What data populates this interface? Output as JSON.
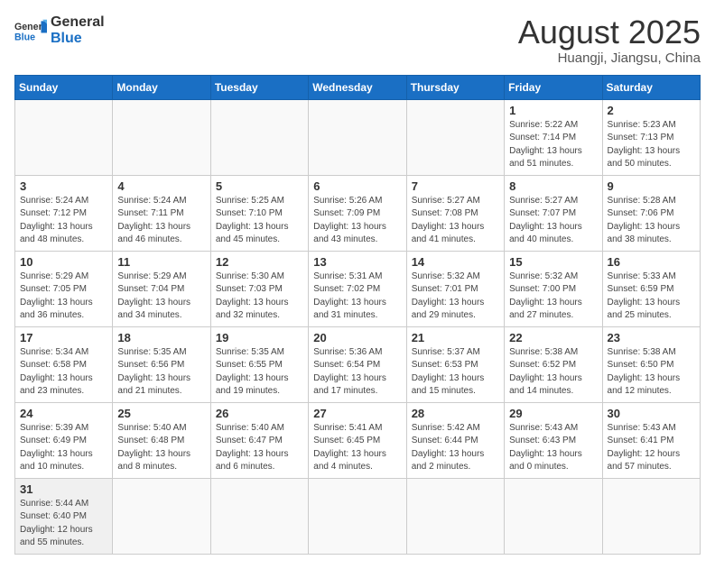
{
  "header": {
    "logo_general": "General",
    "logo_blue": "Blue",
    "month_year": "August 2025",
    "location": "Huangji, Jiangsu, China"
  },
  "weekdays": [
    "Sunday",
    "Monday",
    "Tuesday",
    "Wednesday",
    "Thursday",
    "Friday",
    "Saturday"
  ],
  "weeks": [
    [
      {
        "day": "",
        "info": ""
      },
      {
        "day": "",
        "info": ""
      },
      {
        "day": "",
        "info": ""
      },
      {
        "day": "",
        "info": ""
      },
      {
        "day": "",
        "info": ""
      },
      {
        "day": "1",
        "info": "Sunrise: 5:22 AM\nSunset: 7:14 PM\nDaylight: 13 hours and 51 minutes."
      },
      {
        "day": "2",
        "info": "Sunrise: 5:23 AM\nSunset: 7:13 PM\nDaylight: 13 hours and 50 minutes."
      }
    ],
    [
      {
        "day": "3",
        "info": "Sunrise: 5:24 AM\nSunset: 7:12 PM\nDaylight: 13 hours and 48 minutes."
      },
      {
        "day": "4",
        "info": "Sunrise: 5:24 AM\nSunset: 7:11 PM\nDaylight: 13 hours and 46 minutes."
      },
      {
        "day": "5",
        "info": "Sunrise: 5:25 AM\nSunset: 7:10 PM\nDaylight: 13 hours and 45 minutes."
      },
      {
        "day": "6",
        "info": "Sunrise: 5:26 AM\nSunset: 7:09 PM\nDaylight: 13 hours and 43 minutes."
      },
      {
        "day": "7",
        "info": "Sunrise: 5:27 AM\nSunset: 7:08 PM\nDaylight: 13 hours and 41 minutes."
      },
      {
        "day": "8",
        "info": "Sunrise: 5:27 AM\nSunset: 7:07 PM\nDaylight: 13 hours and 40 minutes."
      },
      {
        "day": "9",
        "info": "Sunrise: 5:28 AM\nSunset: 7:06 PM\nDaylight: 13 hours and 38 minutes."
      }
    ],
    [
      {
        "day": "10",
        "info": "Sunrise: 5:29 AM\nSunset: 7:05 PM\nDaylight: 13 hours and 36 minutes."
      },
      {
        "day": "11",
        "info": "Sunrise: 5:29 AM\nSunset: 7:04 PM\nDaylight: 13 hours and 34 minutes."
      },
      {
        "day": "12",
        "info": "Sunrise: 5:30 AM\nSunset: 7:03 PM\nDaylight: 13 hours and 32 minutes."
      },
      {
        "day": "13",
        "info": "Sunrise: 5:31 AM\nSunset: 7:02 PM\nDaylight: 13 hours and 31 minutes."
      },
      {
        "day": "14",
        "info": "Sunrise: 5:32 AM\nSunset: 7:01 PM\nDaylight: 13 hours and 29 minutes."
      },
      {
        "day": "15",
        "info": "Sunrise: 5:32 AM\nSunset: 7:00 PM\nDaylight: 13 hours and 27 minutes."
      },
      {
        "day": "16",
        "info": "Sunrise: 5:33 AM\nSunset: 6:59 PM\nDaylight: 13 hours and 25 minutes."
      }
    ],
    [
      {
        "day": "17",
        "info": "Sunrise: 5:34 AM\nSunset: 6:58 PM\nDaylight: 13 hours and 23 minutes."
      },
      {
        "day": "18",
        "info": "Sunrise: 5:35 AM\nSunset: 6:56 PM\nDaylight: 13 hours and 21 minutes."
      },
      {
        "day": "19",
        "info": "Sunrise: 5:35 AM\nSunset: 6:55 PM\nDaylight: 13 hours and 19 minutes."
      },
      {
        "day": "20",
        "info": "Sunrise: 5:36 AM\nSunset: 6:54 PM\nDaylight: 13 hours and 17 minutes."
      },
      {
        "day": "21",
        "info": "Sunrise: 5:37 AM\nSunset: 6:53 PM\nDaylight: 13 hours and 15 minutes."
      },
      {
        "day": "22",
        "info": "Sunrise: 5:38 AM\nSunset: 6:52 PM\nDaylight: 13 hours and 14 minutes."
      },
      {
        "day": "23",
        "info": "Sunrise: 5:38 AM\nSunset: 6:50 PM\nDaylight: 13 hours and 12 minutes."
      }
    ],
    [
      {
        "day": "24",
        "info": "Sunrise: 5:39 AM\nSunset: 6:49 PM\nDaylight: 13 hours and 10 minutes."
      },
      {
        "day": "25",
        "info": "Sunrise: 5:40 AM\nSunset: 6:48 PM\nDaylight: 13 hours and 8 minutes."
      },
      {
        "day": "26",
        "info": "Sunrise: 5:40 AM\nSunset: 6:47 PM\nDaylight: 13 hours and 6 minutes."
      },
      {
        "day": "27",
        "info": "Sunrise: 5:41 AM\nSunset: 6:45 PM\nDaylight: 13 hours and 4 minutes."
      },
      {
        "day": "28",
        "info": "Sunrise: 5:42 AM\nSunset: 6:44 PM\nDaylight: 13 hours and 2 minutes."
      },
      {
        "day": "29",
        "info": "Sunrise: 5:43 AM\nSunset: 6:43 PM\nDaylight: 13 hours and 0 minutes."
      },
      {
        "day": "30",
        "info": "Sunrise: 5:43 AM\nSunset: 6:41 PM\nDaylight: 12 hours and 57 minutes."
      }
    ],
    [
      {
        "day": "31",
        "info": "Sunrise: 5:44 AM\nSunset: 6:40 PM\nDaylight: 12 hours and 55 minutes."
      },
      {
        "day": "",
        "info": ""
      },
      {
        "day": "",
        "info": ""
      },
      {
        "day": "",
        "info": ""
      },
      {
        "day": "",
        "info": ""
      },
      {
        "day": "",
        "info": ""
      },
      {
        "day": "",
        "info": ""
      }
    ]
  ]
}
